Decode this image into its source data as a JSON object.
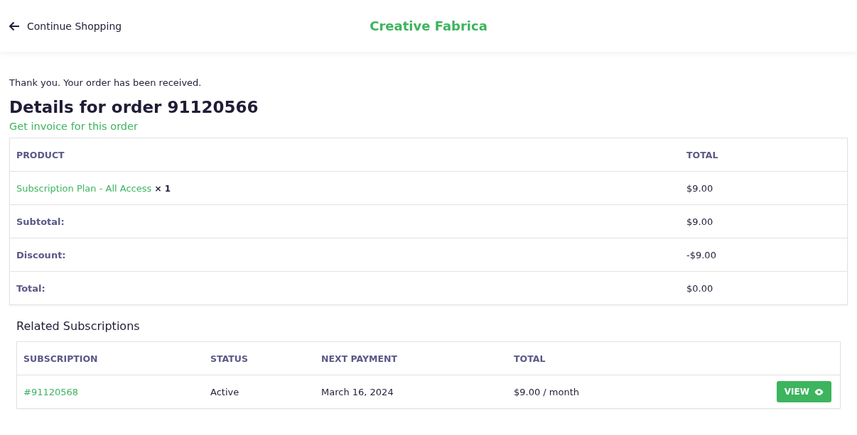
{
  "header": {
    "back_link": "Continue Shopping",
    "brand": "Creative Fabrica"
  },
  "notice": "Thank you. Your order has been received.",
  "title": "Details for order 91120566",
  "invoice_link": "Get invoice for this order",
  "order_table": {
    "columns": [
      "PRODUCT",
      "TOTAL"
    ],
    "rows": [
      {
        "kind": "item",
        "label": "Subscription Plan - All Access",
        "quantity": "× 1",
        "value": "$9.00"
      },
      {
        "kind": "summary",
        "label": "Subtotal:",
        "value": "$9.00"
      },
      {
        "kind": "summary",
        "label": "Discount:",
        "value": "-$9.00"
      },
      {
        "kind": "summary",
        "label": "Total:",
        "value": "$0.00"
      }
    ]
  },
  "subscriptions": {
    "title": "Related Subscriptions",
    "columns": [
      "SUBSCRIPTION",
      "STATUS",
      "NEXT PAYMENT",
      "TOTAL"
    ],
    "rows": [
      {
        "id": "#91120568",
        "status": "Active",
        "next_payment": "March 16, 2024",
        "total": "$9.00 / month",
        "action": "VIEW"
      }
    ]
  }
}
